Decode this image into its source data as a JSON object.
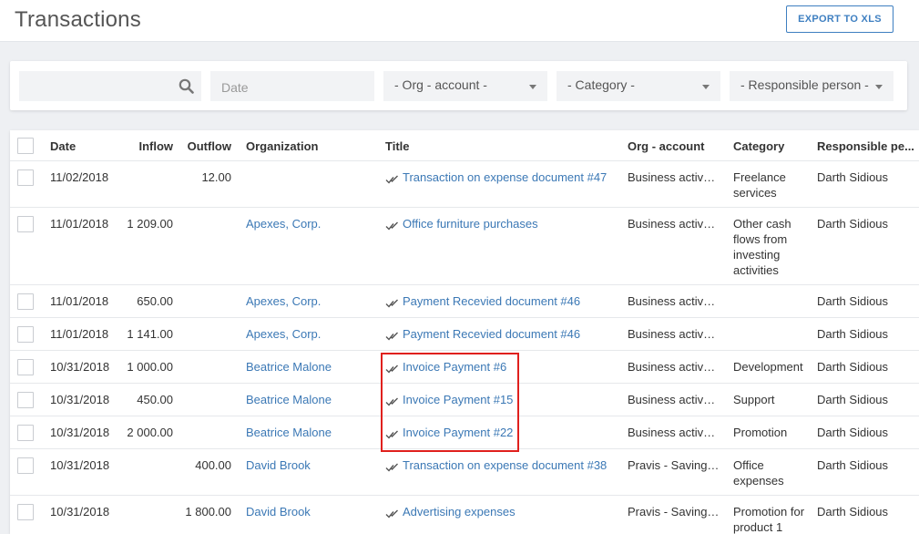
{
  "header": {
    "title": "Transactions",
    "export_label": "EXPORT TO XLS"
  },
  "filters": {
    "search_placeholder": "",
    "date_placeholder": "Date",
    "org_account": "- Org - account -",
    "category": "- Category -",
    "responsible": "- Responsible person -"
  },
  "columns": {
    "date": "Date",
    "inflow": "Inflow",
    "outflow": "Outflow",
    "organization": "Organization",
    "title": "Title",
    "org_account": "Org - account",
    "category": "Category",
    "responsible": "Responsible pe..."
  },
  "rows": [
    {
      "date": "11/02/2018",
      "inflow": "",
      "outflow": "12.00",
      "organization": "",
      "title": "Transaction on expense document #47",
      "org_account": "Business activat...",
      "category": "Freelance services",
      "responsible": "Darth Sidious"
    },
    {
      "date": "11/01/2018",
      "inflow": "1 209.00",
      "outflow": "",
      "organization": "Apexes, Corp.",
      "title": "Office furniture purchases",
      "org_account": "Business activat...",
      "category": "Other cash flows from investing activities",
      "responsible": "Darth Sidious"
    },
    {
      "date": "11/01/2018",
      "inflow": "650.00",
      "outflow": "",
      "organization": "Apexes, Corp.",
      "title": "Payment Recevied document #46",
      "org_account": "Business activat...",
      "category": "",
      "responsible": "Darth Sidious"
    },
    {
      "date": "11/01/2018",
      "inflow": "1 141.00",
      "outflow": "",
      "organization": "Apexes, Corp.",
      "title": "Payment Recevied document #46",
      "org_account": "Business activat...",
      "category": "",
      "responsible": "Darth Sidious"
    },
    {
      "date": "10/31/2018",
      "inflow": "1 000.00",
      "outflow": "",
      "organization": "Beatrice Malone",
      "title": "Invoice Payment #6",
      "org_account": "Business activat...",
      "category": "Development",
      "responsible": "Darth Sidious"
    },
    {
      "date": "10/31/2018",
      "inflow": "450.00",
      "outflow": "",
      "organization": "Beatrice Malone",
      "title": "Invoice Payment #15",
      "org_account": "Business activat...",
      "category": "Support",
      "responsible": "Darth Sidious"
    },
    {
      "date": "10/31/2018",
      "inflow": "2 000.00",
      "outflow": "",
      "organization": "Beatrice Malone",
      "title": "Invoice Payment #22",
      "org_account": "Business activat...",
      "category": "Promotion",
      "responsible": "Darth Sidious"
    },
    {
      "date": "10/31/2018",
      "inflow": "",
      "outflow": "400.00",
      "organization": "David Brook",
      "title": "Transaction on expense document #38",
      "org_account": "Pravis - Savings ...",
      "category": "Office expenses",
      "responsible": "Darth Sidious"
    },
    {
      "date": "10/31/2018",
      "inflow": "",
      "outflow": "1 800.00",
      "organization": "David Brook",
      "title": "Advertising expenses",
      "org_account": "Pravis - Savings ...",
      "category": "Promotion for product 1",
      "responsible": "Darth Sidious"
    }
  ],
  "colors": {
    "link": "#3b78b5",
    "highlight": "#e0201d",
    "accent": "#3e7fc1"
  }
}
